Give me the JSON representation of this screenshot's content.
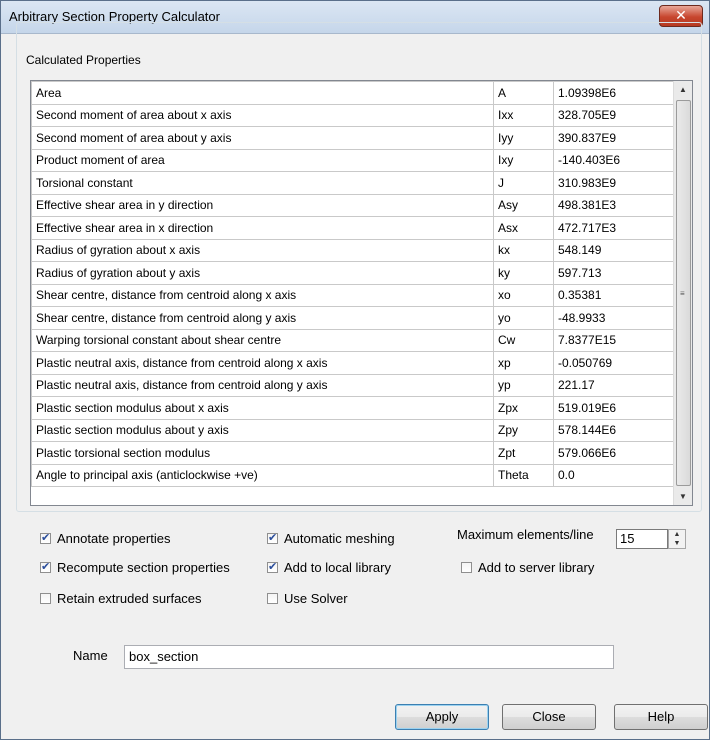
{
  "window": {
    "title": "Arbitrary Section Property Calculator",
    "close_glyph": "✕"
  },
  "group": {
    "legend": "Calculated Properties"
  },
  "properties": [
    {
      "name": "Area",
      "symbol": "A",
      "value": "1.09398E6"
    },
    {
      "name": "Second moment of area about x axis",
      "symbol": "Ixx",
      "value": "328.705E9"
    },
    {
      "name": "Second moment of area about y axis",
      "symbol": "Iyy",
      "value": "390.837E9"
    },
    {
      "name": "Product moment of area",
      "symbol": "Ixy",
      "value": "-140.403E6"
    },
    {
      "name": "Torsional constant",
      "symbol": "J",
      "value": "310.983E9"
    },
    {
      "name": "Effective shear area in y direction",
      "symbol": "Asy",
      "value": "498.381E3"
    },
    {
      "name": "Effective shear area in x direction",
      "symbol": "Asx",
      "value": "472.717E3"
    },
    {
      "name": "Radius of gyration about x axis",
      "symbol": "kx",
      "value": "548.149"
    },
    {
      "name": "Radius of gyration about y axis",
      "symbol": "ky",
      "value": "597.713"
    },
    {
      "name": "Shear centre, distance from centroid along  x axis",
      "symbol": "xo",
      "value": "0.35381"
    },
    {
      "name": "Shear centre, distance from centroid along  y axis",
      "symbol": "yo",
      "value": "-48.9933"
    },
    {
      "name": "Warping torsional constant about shear centre",
      "symbol": "Cw",
      "value": "7.8377E15"
    },
    {
      "name": "Plastic neutral axis, distance from centroid along x axis",
      "symbol": "xp",
      "value": "-0.050769"
    },
    {
      "name": "Plastic neutral axis, distance from centroid along y axis",
      "symbol": "yp",
      "value": "221.17"
    },
    {
      "name": "Plastic section modulus about x axis",
      "symbol": "Zpx",
      "value": "519.019E6"
    },
    {
      "name": "Plastic section modulus about y axis",
      "symbol": "Zpy",
      "value": "578.144E6"
    },
    {
      "name": "Plastic torsional section modulus",
      "symbol": "Zpt",
      "value": "579.066E6"
    },
    {
      "name": "Angle to principal axis (anticlockwise +ve)",
      "symbol": "Theta",
      "value": "0.0"
    }
  ],
  "options": {
    "annotate_properties": {
      "label": "Annotate properties",
      "checked": true
    },
    "recompute": {
      "label": "Recompute section properties",
      "checked": true
    },
    "retain_extruded": {
      "label": "Retain extruded surfaces",
      "checked": false
    },
    "automatic_meshing": {
      "label": "Automatic meshing",
      "checked": true
    },
    "add_local": {
      "label": "Add to local library",
      "checked": true
    },
    "use_solver": {
      "label": "Use Solver",
      "checked": false
    },
    "add_server": {
      "label": "Add to server library",
      "checked": false
    }
  },
  "max_elements": {
    "label": "Maximum elements/line",
    "value": "15"
  },
  "name_field": {
    "label": "Name",
    "value": "box_section"
  },
  "buttons": {
    "apply": "Apply",
    "close": "Close",
    "help": "Help"
  },
  "icons": {
    "scroll_up": "scroll-up-icon",
    "scroll_down": "scroll-down-icon",
    "spin_up": "spin-up-icon",
    "spin_down": "spin-down-icon"
  }
}
